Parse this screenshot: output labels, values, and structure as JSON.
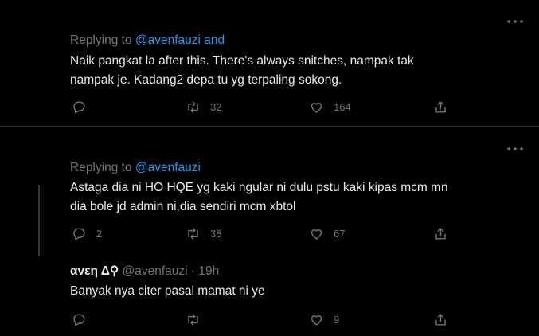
{
  "tweets": [
    {
      "replying_prefix": "Replying to",
      "replying_to": "@avenfauzi and",
      "text_lines": [
        "Naik pangkat la after this. There's always snitches, nampak tak",
        "nampak je. Kadang2 depa tu yg terpaling sokong."
      ],
      "replies": "",
      "retweets": "32",
      "likes": "164"
    },
    {
      "replying_prefix": "Replying to",
      "replying_to": "@avenfauzi",
      "text_lines": [
        "Astaga dia ni HO HQE yg kaki ngular ni dulu pstu kaki kipas mcm mn",
        "dia bole jd admin ni,dia sendiri mcm xbtol"
      ],
      "replies": "2",
      "retweets": "38",
      "likes": "67"
    },
    {
      "author_name": "αvεη Δ⚲",
      "handle": "@avenfauzi",
      "separator": "·",
      "time": "19h",
      "text_lines": [
        "Banyak nya citer pasal mamat ni ye"
      ],
      "replies": "",
      "retweets": "",
      "likes": "9"
    }
  ],
  "icons": {
    "reply": "reply-icon",
    "retweet": "retweet-icon",
    "like": "heart-icon",
    "share": "share-icon",
    "more": "more-icon"
  },
  "colors": {
    "background": "#000000",
    "text": "#e7e9ea",
    "muted": "#6e767d",
    "mention": "#1d9bf0",
    "divider": "#2f3336"
  }
}
